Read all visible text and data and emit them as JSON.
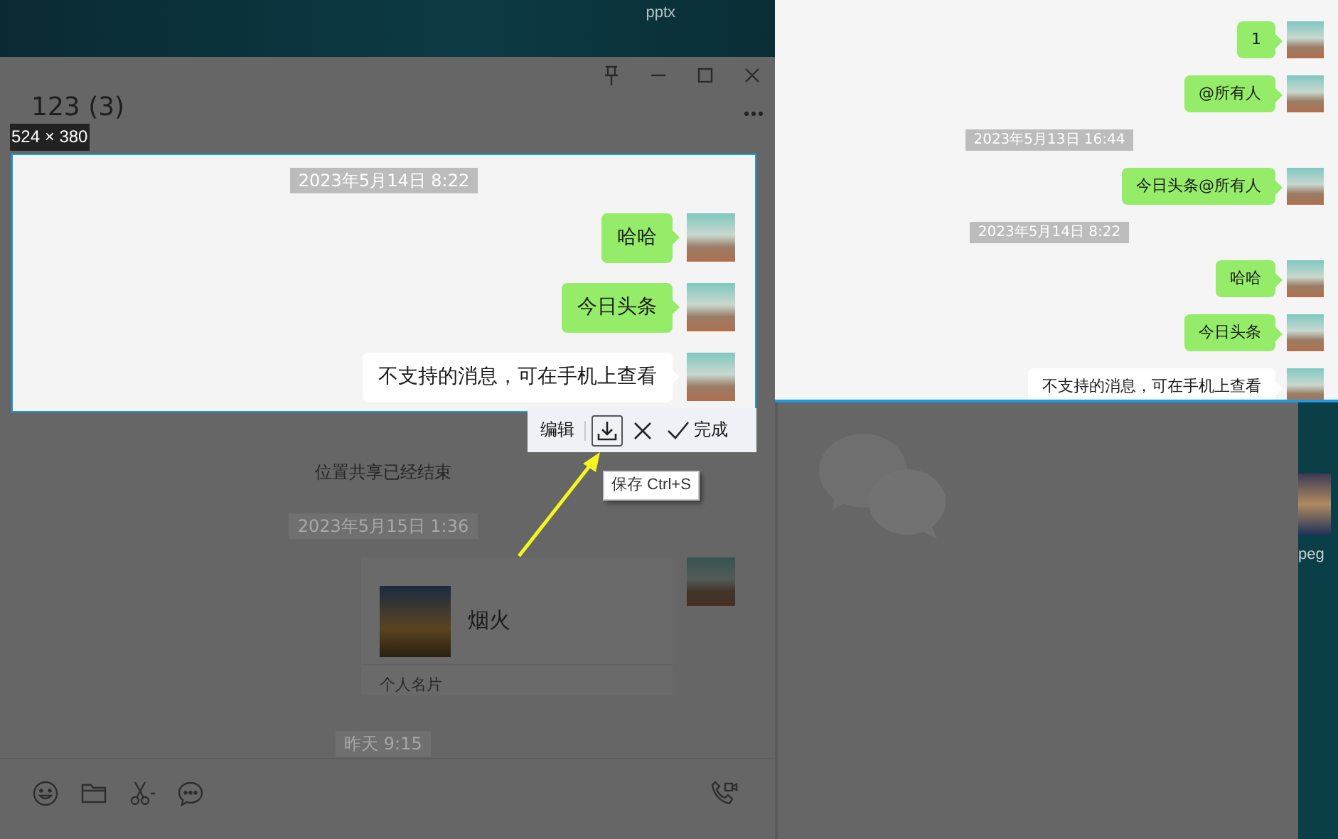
{
  "desktop": {
    "file_label_top": "pptx",
    "file_label_right": "peg"
  },
  "chat_window": {
    "title": "123 (3)",
    "highlighted_messages": [
      {
        "kind": "timestamp",
        "text": "2023年5月14日 8:22"
      },
      {
        "kind": "text",
        "text": "哈哈"
      },
      {
        "kind": "text",
        "text": "今日头条"
      },
      {
        "kind": "unsupported",
        "text": "不支持的消息，可在手机上查看"
      }
    ],
    "dimmed_messages": [
      {
        "kind": "system",
        "text": "位置共享已经结束"
      },
      {
        "kind": "timestamp",
        "text": "2023年5月15日 1:36"
      },
      {
        "kind": "card",
        "text": "烟火",
        "footer": "个人名片"
      },
      {
        "kind": "timestamp",
        "text": "昨天 9:15"
      }
    ]
  },
  "selection": {
    "size_label": "524 × 380"
  },
  "screenshot_toolbar": {
    "items": [
      {
        "kind": "text",
        "label": "编辑",
        "selected": false
      },
      {
        "kind": "save",
        "selected": true
      },
      {
        "kind": "cancel",
        "selected": false
      },
      {
        "kind": "done",
        "label": "完成",
        "selected": false
      }
    ],
    "tooltip": "保存 Ctrl+S"
  },
  "pinned_preview": {
    "messages": [
      {
        "kind": "text",
        "text": "1"
      },
      {
        "kind": "text",
        "text": "@所有人"
      },
      {
        "kind": "timestamp",
        "text": "2023年5月13日 16:44"
      },
      {
        "kind": "text",
        "text": "今日头条@所有人"
      },
      {
        "kind": "timestamp",
        "text": "2023年5月14日 8:22"
      },
      {
        "kind": "text",
        "text": "哈哈"
      },
      {
        "kind": "text",
        "text": "今日头条"
      },
      {
        "kind": "unsupported",
        "text": "不支持的消息，可在手机上查看"
      }
    ]
  }
}
